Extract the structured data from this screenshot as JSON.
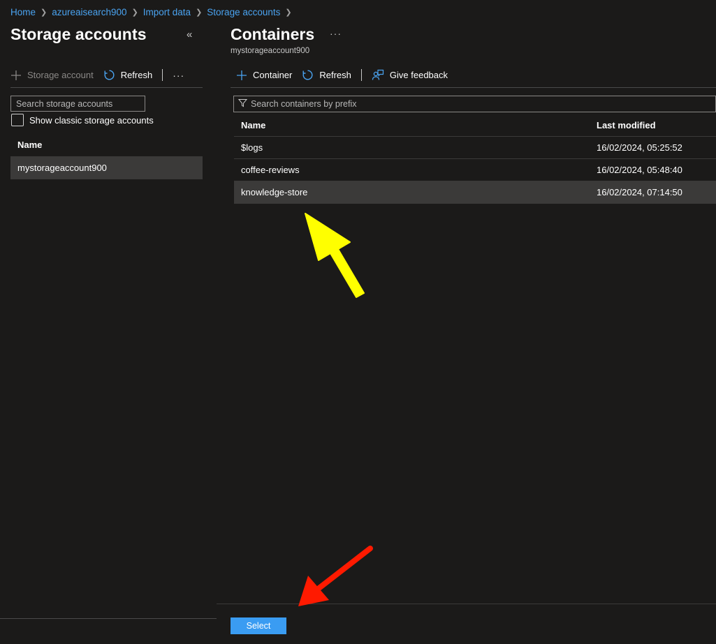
{
  "breadcrumb": {
    "items": [
      "Home",
      "azureaisearch900",
      "Import data",
      "Storage accounts"
    ]
  },
  "left": {
    "title": "Storage accounts",
    "toolbar": {
      "add_label": "Storage account",
      "refresh_label": "Refresh",
      "more": "···"
    },
    "search_placeholder": "Search storage accounts",
    "classic_label": "Show classic storage accounts",
    "column_name": "Name",
    "rows": [
      "mystorageaccount900"
    ]
  },
  "right": {
    "title": "Containers",
    "subtitle": "mystorageaccount900",
    "more": "···",
    "toolbar": {
      "container_label": "Container",
      "refresh_label": "Refresh",
      "feedback_label": "Give feedback"
    },
    "search_placeholder": "Search containers by prefix",
    "columns": {
      "name": "Name",
      "modified": "Last modified"
    },
    "rows": [
      {
        "name": "$logs",
        "modified": "16/02/2024, 05:25:52"
      },
      {
        "name": "coffee-reviews",
        "modified": "16/02/2024, 05:48:40"
      },
      {
        "name": "knowledge-store",
        "modified": "16/02/2024, 07:14:50"
      }
    ],
    "select_label": "Select"
  },
  "colors": {
    "accent": "#3a9cf2",
    "link": "#4aa3f0",
    "background": "#1b1a19",
    "selected_row": "#3b3a39",
    "annotation_yellow": "#ffff00",
    "annotation_red": "#ff1a00"
  }
}
